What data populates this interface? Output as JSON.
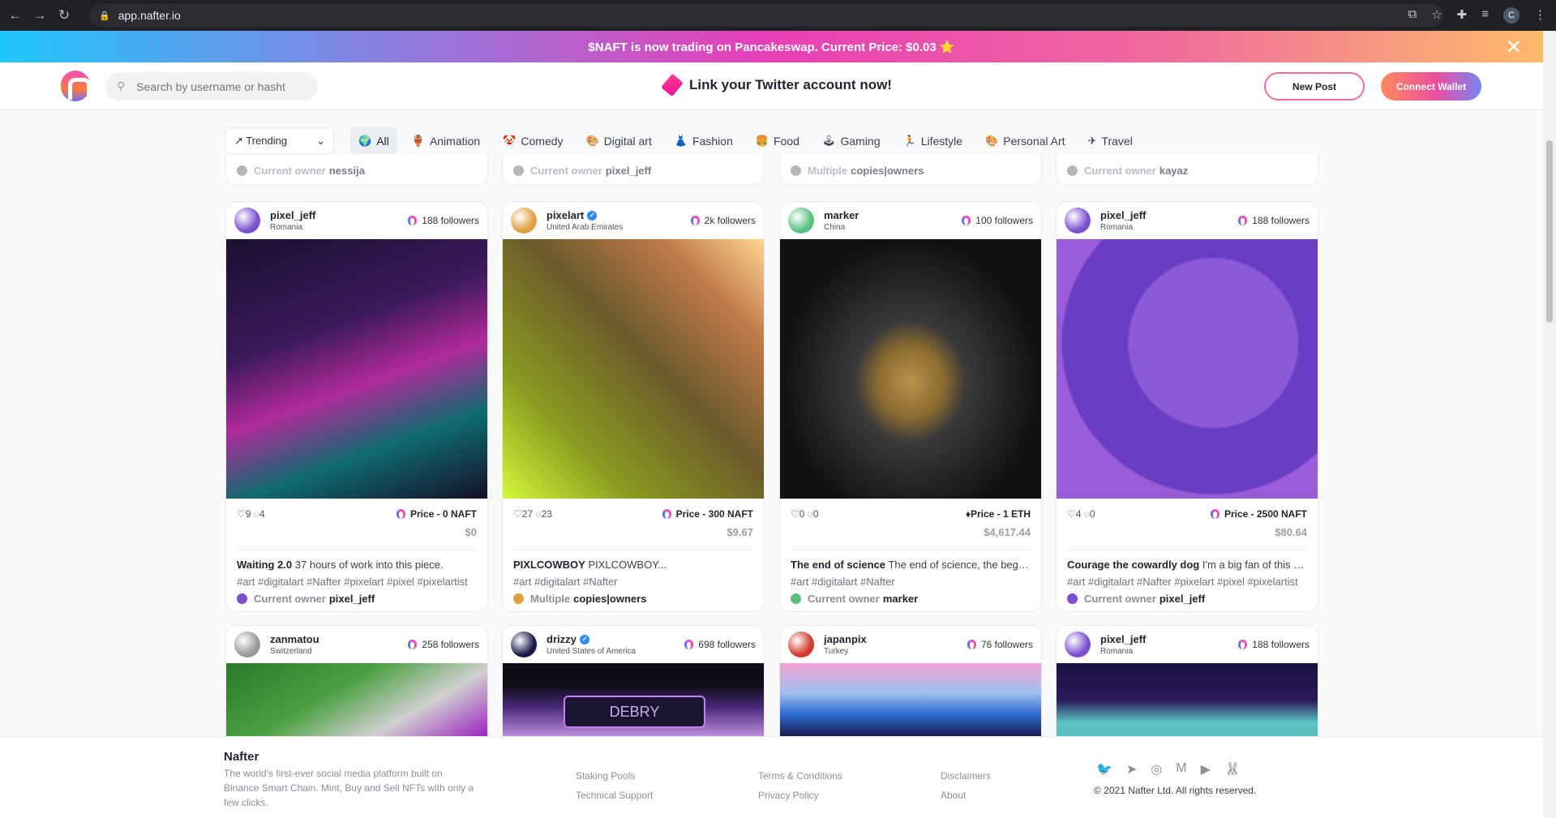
{
  "browser": {
    "url": "app.nafter.io",
    "profile_initial": "C"
  },
  "banner": {
    "text": "$NAFT is now trading on Pancakeswap. Current Price: $0.03 ⭐",
    "close": "✕"
  },
  "header": {
    "search_placeholder": "Search by username or hasht",
    "twitter_cta": "Link your Twitter account now!",
    "new_post": "New Post",
    "connect_wallet": "Connect Wallet"
  },
  "filters": {
    "sort": "Trending",
    "categories": [
      {
        "emoji": "🌍",
        "label": "All"
      },
      {
        "emoji": "🏺",
        "label": "Animation"
      },
      {
        "emoji": "🤡",
        "label": "Comedy"
      },
      {
        "emoji": "🎨",
        "label": "Digital art"
      },
      {
        "emoji": "👗",
        "label": "Fashion"
      },
      {
        "emoji": "🍔",
        "label": "Food"
      },
      {
        "emoji": "🕹",
        "label": "Gaming"
      },
      {
        "emoji": "🏃",
        "label": "Lifestyle"
      },
      {
        "emoji": "🎨",
        "label": "Personal Art"
      },
      {
        "emoji": "✈",
        "label": "Travel"
      }
    ]
  },
  "partial_cards": [
    {
      "owner_label": "Current owner",
      "owner": "nessija"
    },
    {
      "owner_label": "Current owner",
      "owner": "pixel_jeff"
    },
    {
      "owner_label": "Multiple",
      "owner": "copies|owners"
    },
    {
      "owner_label": "Current owner",
      "owner": "kayaz"
    }
  ],
  "cards": [
    {
      "user": "pixel_jeff",
      "country": "Romania",
      "verified": false,
      "followers": "188 followers",
      "likes": "9",
      "comments": "4",
      "price": "Price - 0 NAFT",
      "usd": "$0",
      "title": "Waiting 2.0",
      "desc": "37 hours of work into this piece.",
      "tags": "#art #digitalart #Nafter #pixelart #pixel #pixelartist",
      "owner_label": "Current owner",
      "owner": "pixel_jeff",
      "avatar": "#7b4fd0",
      "art": "linear-gradient(160deg,#1a1030,#3a1a5a 35%,#b02a9a 55%,#0f6b70 75%,#151028)"
    },
    {
      "user": "pixelart",
      "country": "United Arab Emirates",
      "verified": true,
      "followers": "2k followers",
      "likes": "27",
      "comments": "23",
      "price": "Price - 300 NAFT",
      "usd": "$9.67",
      "title": "PIXLCOWBOY",
      "desc": "PIXLCOWBOY...",
      "tags": "#art #digitalart #Nafter",
      "owner_label": "Multiple",
      "owner": "copies|owners",
      "avatar": "#e0a040",
      "art": "linear-gradient(225deg,#ffd690,#c07a4a 20%,#6b5a2a 45%,#8a9a20 75%,#d4f83a)"
    },
    {
      "user": "marker",
      "country": "China",
      "verified": false,
      "followers": "100 followers",
      "likes": "0",
      "comments": "0",
      "price": "Price - 1 ETH",
      "usd": "$4,617.44",
      "title": "The end of science",
      "desc": "The end of science, the beginning of faith",
      "tags": "#art #digitalart #Nafter",
      "owner_label": "Current owner",
      "owner": "marker",
      "avatar": "#5ac080",
      "art": "radial-gradient(ellipse at 50% 55%,#b8934a 0,#8a6a30 18%,#3a3a3a 30%,#111 70%)"
    },
    {
      "user": "pixel_jeff",
      "country": "Romania",
      "verified": false,
      "followers": "188 followers",
      "likes": "4",
      "comments": "0",
      "price": "Price - 2500 NAFT",
      "usd": "$80.64",
      "title": "Courage the cowardly dog",
      "desc": "I'm a big fan of this cartoon",
      "tags": "#art #digitalart #Nafter #pixelart #pixel #pixelartist",
      "owner_label": "Current owner",
      "owner": "pixel_jeff",
      "avatar": "#7b4fd0",
      "art": "radial-gradient(circle at 60% 40%,#8a5ad8 0,#8a5ad8 38%,#6a3ec4 39%,#6a3ec4 68%,#9a5cd8 69%)"
    },
    {
      "user": "zanmatou",
      "country": "Switzerland",
      "verified": false,
      "followers": "258 followers",
      "avatar": "#999",
      "art": "linear-gradient(150deg,#2a7a2a,#4aa040 40%,#d0d0d0 70%,#9a20c0)"
    },
    {
      "user": "drizzy",
      "country": "United States of America",
      "verified": true,
      "followers": "698 followers",
      "avatar": "#1a1a4a",
      "art": "linear-gradient(180deg,#0e0d18 30%,#4a2a7a 60%,#c090e0)",
      "caption": "DEBRY"
    },
    {
      "user": "japanpix",
      "country": "Turkey",
      "verified": false,
      "followers": "76 followers",
      "avatar": "#d03a2a",
      "art": "linear-gradient(180deg,#f0a0d0,#a0c0f0 40%,#2a6ad0 70%,#1a1a4a)"
    },
    {
      "user": "pixel_jeff",
      "country": "Romania",
      "verified": false,
      "followers": "188 followers",
      "avatar": "#7b4fd0",
      "art": "linear-gradient(180deg,#1a1040,#2a1a5a 50%,#5ac0c0 80%)"
    }
  ],
  "footer": {
    "brand": "Nafter",
    "tagline": "The world's first-ever social media platform built on Binance Smart Chain. Mint, Buy and Sell NFTs with only a few clicks.",
    "links": [
      "Staking Pools",
      "Technical Support",
      "Terms & Conditions",
      "Privacy Policy",
      "Disclaimers",
      "About"
    ],
    "social": [
      {
        "name": "twitter",
        "glyph": "🐦"
      },
      {
        "name": "telegram",
        "glyph": "➤"
      },
      {
        "name": "instagram",
        "glyph": "◎"
      },
      {
        "name": "medium",
        "glyph": "M"
      },
      {
        "name": "youtube",
        "glyph": "▶"
      },
      {
        "name": "pancakeswap",
        "glyph": "🐰"
      }
    ],
    "copyright": "© 2021 Nafter Ltd. All rights reserved."
  }
}
